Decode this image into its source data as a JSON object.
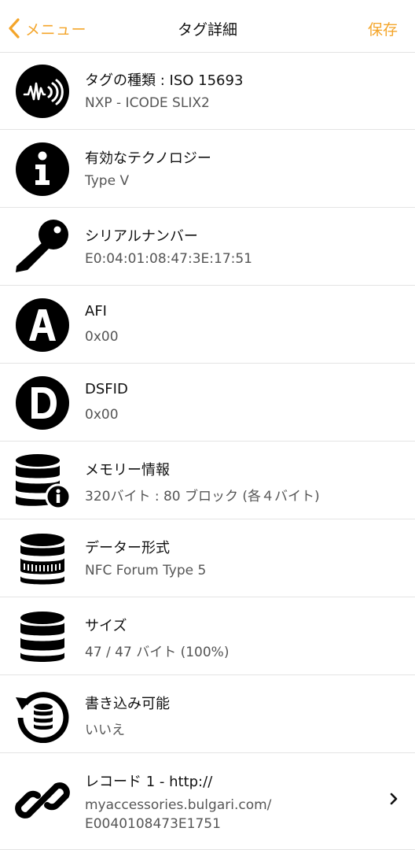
{
  "nav": {
    "back_label": "メニュー",
    "title": "タグ詳細",
    "save_label": "保存",
    "accent_color": "#f4a52a"
  },
  "rows": [
    {
      "icon": "nfc-tag-icon",
      "title": "タグの種類 : ISO 15693",
      "sub": "NXP - ICODE SLIX2"
    },
    {
      "icon": "info-icon",
      "title": "有効なテクノロジー",
      "sub": "Type V"
    },
    {
      "icon": "key-icon",
      "title": "シリアルナンバー",
      "sub": "E0:04:01:08:47:3E:17:51"
    },
    {
      "icon": "letter-a-icon",
      "title": "AFI",
      "sub": "0x00"
    },
    {
      "icon": "letter-d-icon",
      "title": "DSFID",
      "sub": "0x00"
    },
    {
      "icon": "database-info-icon",
      "title": "メモリー情報",
      "sub": "320バイト : 80 ブロック (各４バイト)"
    },
    {
      "icon": "database-format-icon",
      "title": "データー形式",
      "sub": "NFC Forum Type 5"
    },
    {
      "icon": "database-icon",
      "title": "サイズ",
      "sub": "47 / 47 バイト (100%)"
    },
    {
      "icon": "writable-database-icon",
      "title": "書き込み可能",
      "sub": "いいえ"
    },
    {
      "icon": "link-icon",
      "title": "レコード 1 - http://",
      "sub": "myaccessories.bulgari.com/",
      "sub2": "E0040108473E1751"
    }
  ]
}
